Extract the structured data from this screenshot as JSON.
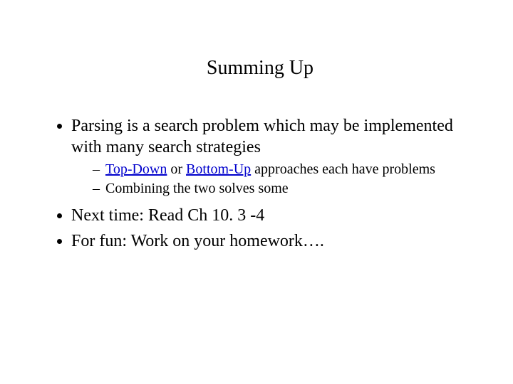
{
  "title": "Summing Up",
  "bullets": {
    "b1": "Parsing is a search problem which may be implemented with many search strategies",
    "b2": "Next time: Read Ch 10. 3 -4",
    "b3": "For fun: Work on your homework….",
    "sub1": {
      "link1": "Top-Down",
      "mid1": " or ",
      "link2": "Bottom-Up",
      "tail": " approaches each have problems"
    },
    "sub2": "Combining the two solves some"
  }
}
